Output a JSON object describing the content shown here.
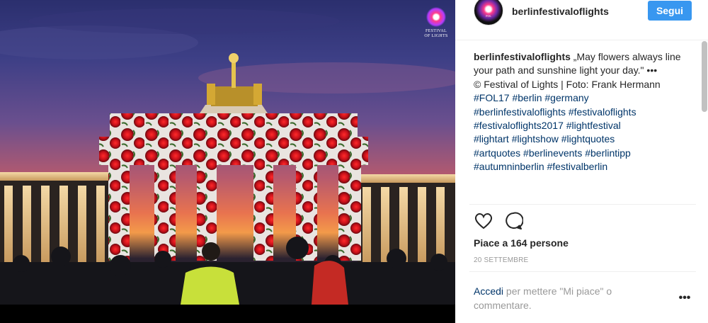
{
  "photo": {
    "logo_text_line1": "FESTIVAL",
    "logo_text_line2": "OF LIGHTS",
    "logo_badge": "FOL"
  },
  "header": {
    "username": "berlinfestivaloflights",
    "follow_label": "Segui"
  },
  "caption": {
    "username": "berlinfestivaloflights",
    "text": " „May flowers always line your path and sunshine light your day.\" •••",
    "credit": "© Festival of Lights | Foto: Frank Hermann",
    "hashtags_lines": [
      "#FOL17 #berlin #germany",
      "#berlinfestivaloflights #festivaloflights",
      "#festivaloflights2017 #lightfestival",
      "#lightart #lightshow #lightquotes",
      "#artquotes #berlinevents #berlintipp",
      "#autumninberlin #festivalberlin"
    ]
  },
  "actions": {
    "like_icon": "heart-icon",
    "comment_icon": "comment-icon"
  },
  "likes": "Piace a 164 persone",
  "date": "20 SETTEMBRE",
  "login_prompt": {
    "link": "Accedi",
    "text": " per mettere \"Mi piace\" o commentare."
  },
  "more_label": "•••",
  "colors": {
    "accent_blue": "#3897f0",
    "link_blue": "#003569",
    "text": "#262626",
    "muted": "#999999"
  }
}
